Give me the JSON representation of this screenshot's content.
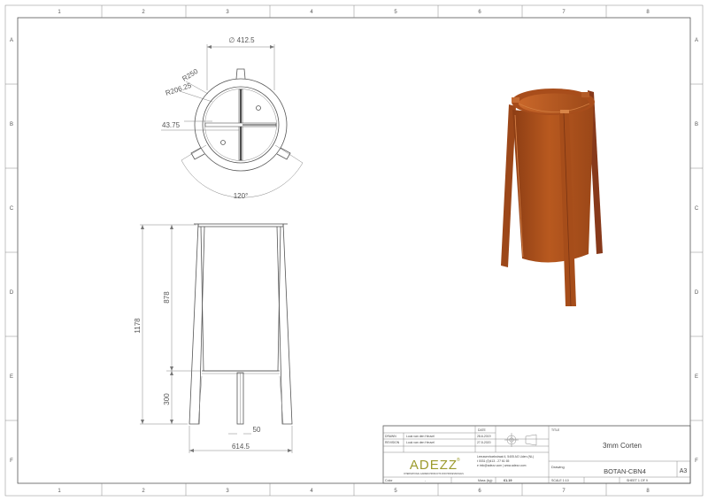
{
  "border": {
    "columns": [
      "1",
      "2",
      "3",
      "4",
      "5",
      "6",
      "7",
      "8"
    ],
    "rows": [
      "A",
      "B",
      "C",
      "D",
      "E",
      "F"
    ]
  },
  "top_view": {
    "diameter": "∅ 412.5",
    "r_outer": "R250",
    "r_inner": "R206.25",
    "offset": "43.75",
    "angle": "120°"
  },
  "front_view": {
    "height_total": "1178",
    "height_body": "878",
    "height_leg": "300",
    "leg_width": "50",
    "overall_width": "614.5"
  },
  "title_block": {
    "logo_text": "ADEZZ",
    "logo_tagline": "INTERNATIONAL GARDEN PRODUCTS FOR PROFESSIONALS",
    "date_header": "DATE",
    "drawn_label": "DRAWN",
    "drawn_by": "Luuk van den Heuvel",
    "drawn_date": "28-6-2019",
    "revision_label": "REVISION",
    "revision_by": "Luuk van den Heuvel",
    "revision_date": "27-5-2020",
    "address_line1": "Leeuwenhoekstraat 4, 5405 AG Uden (NL)",
    "address_line2": "t 0031 (0)413 - 27 61 65",
    "address_line3": "e info@adezz.com | www.adezz.com",
    "title_label": "TITLE",
    "title_value": "3mm Corten",
    "drawing_label": "Drawing",
    "drawing_value": "BOTAN-CBN4",
    "sheet_size": "A3",
    "color_label": "Color",
    "color_value": "-",
    "mass_label": "Mass (kg):",
    "mass_value": "61.19",
    "scale": "SCALE 1:10",
    "sheet": "SHEET 1 OF 9"
  },
  "colors": {
    "corten": "#b5581f",
    "corten_dark": "#8a3d14",
    "logo": "#9c9a2c"
  }
}
